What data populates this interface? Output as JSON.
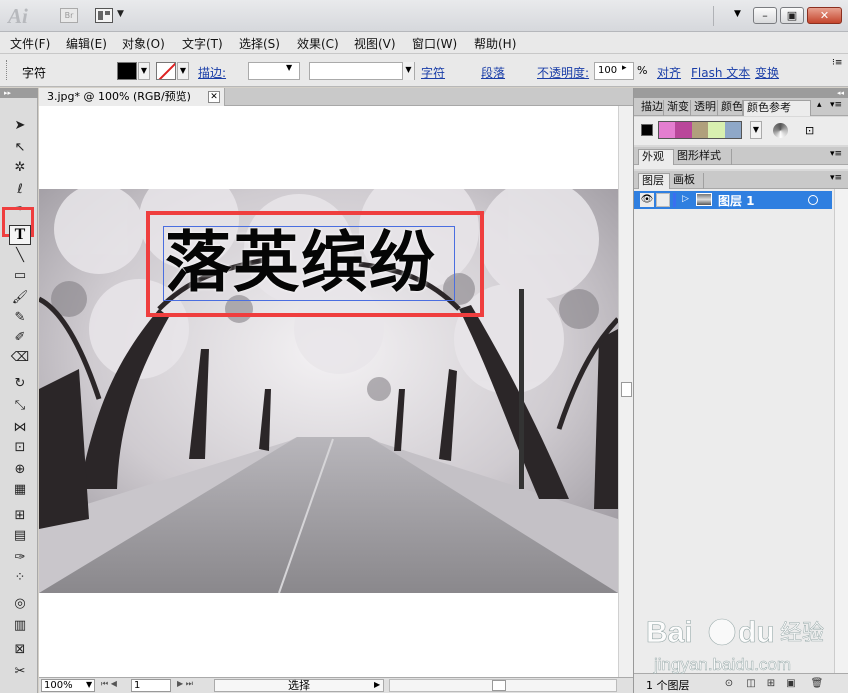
{
  "app": {
    "logo": "Ai",
    "bridge_label": "Br",
    "colors": {
      "accent_selection": "#2f7fe0",
      "annotation_red": "#ef3e3e"
    }
  },
  "menu": {
    "items": [
      {
        "label": "文件(F)"
      },
      {
        "label": "编辑(E)"
      },
      {
        "label": "对象(O)"
      },
      {
        "label": "文字(T)"
      },
      {
        "label": "选择(S)"
      },
      {
        "label": "效果(C)"
      },
      {
        "label": "视图(V)"
      },
      {
        "label": "窗口(W)"
      },
      {
        "label": "帮助(H)"
      }
    ]
  },
  "control_bar": {
    "tool_label": "字符",
    "stroke_label": "描边:",
    "char_link": "字符",
    "paragraph_link": "段落",
    "opacity_label": "不透明度:",
    "opacity_value": "100",
    "opacity_unit": "%",
    "align_link": "对齐",
    "flash_text_link": "Flash 文本",
    "transform_link": "变换",
    "fill_color": "#000000"
  },
  "document": {
    "tab_title": "3.jpg* @ 100% (RGB/预览)",
    "tab_close": "✕",
    "headline_text": "落英缤纷"
  },
  "status_bar": {
    "zoom": "100%",
    "page": "1",
    "status_text": "选择"
  },
  "panels": {
    "swatch_tabs": [
      "描边",
      "渐变",
      "透明",
      "颜色",
      "颜色参考"
    ],
    "guide_colors": [
      "#e47ed0",
      "#b9479a",
      "#b0a07c",
      "#d8f0b0",
      "#8fa8c8"
    ],
    "appearance_tabs": [
      "外观",
      "图形样式"
    ],
    "layer_tabs": [
      "图层",
      "画板"
    ],
    "layer_name": "图层 1",
    "layer_count": "1 个图层"
  },
  "watermark": {
    "brand": "Baidu",
    "sub": "经验",
    "url": "jingyan.baidu.com"
  }
}
